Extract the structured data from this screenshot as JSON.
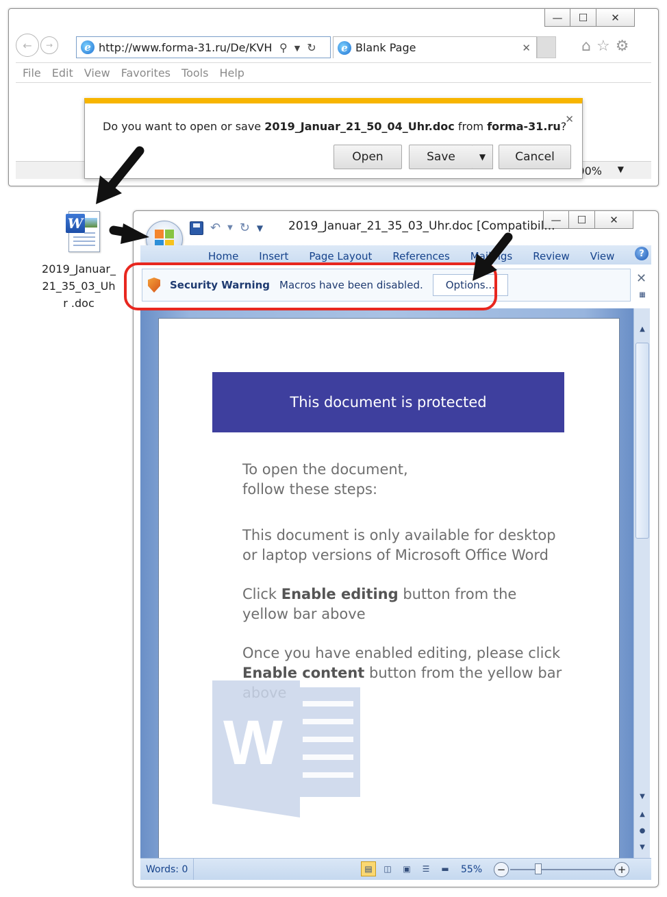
{
  "browser": {
    "address": "http://www.forma-31.ru/De/KVH",
    "tab_title": "Blank Page",
    "menu": [
      "File",
      "Edit",
      "View",
      "Favorites",
      "Tools",
      "Help"
    ],
    "zoom": "100%"
  },
  "download": {
    "prefix": "Do you want to open or save ",
    "filename": "2019_Januar_21_50_04_Uhr.doc",
    "middle": " from ",
    "domain": "forma-31.ru",
    "suffix": "?",
    "open_label": "Open",
    "save_label": "Save",
    "cancel_label": "Cancel"
  },
  "desktop_icon": {
    "label": "2019_Januar_ 21_35_03_Uhr .doc"
  },
  "word": {
    "title": "2019_Januar_21_35_03_Uhr.doc [Compatibil...",
    "tabs": [
      "Home",
      "Insert",
      "Page Layout",
      "References",
      "Mailings",
      "Review",
      "View"
    ],
    "security_title": "Security Warning",
    "security_text": "Macros have been disabled.",
    "options_label": "Options...",
    "status_words": "Words: 0",
    "zoom": "55%"
  },
  "document": {
    "banner": "This document is protected",
    "p1_line1": "To open the document,",
    "p1_line2": "follow these steps:",
    "p2": "This document is only available for desktop or laptop versions of Microsoft Office Word",
    "p3_pre": "Click ",
    "p3_bold": "Enable editing",
    "p3_post": " button from the yellow bar above",
    "p4_pre": "Once you have enabled editing, please click ",
    "p4_bold": "Enable content",
    "p4_post": " button from the yellow bar above",
    "watermark_letter": "W"
  },
  "colors": {
    "banner": "#3e3f9e",
    "highlight": "#e8271f",
    "download_accent": "#f7b500"
  }
}
